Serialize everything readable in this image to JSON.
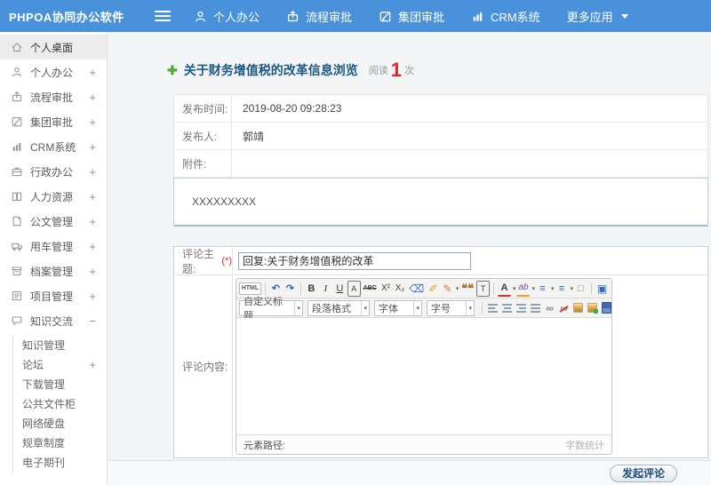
{
  "colors": {
    "header_blue": "#4a91dc",
    "title_blue": "#1c5a85",
    "count_red": "#e8222a",
    "plus_green": "#53a93f"
  },
  "header": {
    "logo": "PHPOA协同办公软件",
    "nav": [
      {
        "label": "个人办公",
        "icon": "user-icon"
      },
      {
        "label": "流程审批",
        "icon": "process-icon"
      },
      {
        "label": "集团审批",
        "icon": "edit-icon"
      },
      {
        "label": "CRM系统",
        "icon": "chart-icon"
      },
      {
        "label": "更多应用",
        "icon": "chevron-down-icon"
      }
    ]
  },
  "sidebar": {
    "items": [
      {
        "label": "个人桌面",
        "icon": "home-icon",
        "expand": "",
        "active": true
      },
      {
        "label": "个人办公",
        "icon": "user-icon",
        "expand": "+"
      },
      {
        "label": "流程审批",
        "icon": "process-icon",
        "expand": "+"
      },
      {
        "label": "集团审批",
        "icon": "edit-icon",
        "expand": "+"
      },
      {
        "label": "CRM系统",
        "icon": "chart-icon",
        "expand": "+"
      },
      {
        "label": "行政办公",
        "icon": "briefcase-icon",
        "expand": "+"
      },
      {
        "label": "人力资源",
        "icon": "book-icon",
        "expand": "+"
      },
      {
        "label": "公文管理",
        "icon": "document-icon",
        "expand": "+"
      },
      {
        "label": "用车管理",
        "icon": "truck-icon",
        "expand": "+"
      },
      {
        "label": "档案管理",
        "icon": "archive-icon",
        "expand": "+"
      },
      {
        "label": "项目管理",
        "icon": "project-icon",
        "expand": "+"
      },
      {
        "label": "知识交流",
        "icon": "chat-icon",
        "expand": "−"
      }
    ],
    "submenu": [
      {
        "label": "知识管理",
        "expand": ""
      },
      {
        "label": "论坛",
        "expand": "+"
      },
      {
        "label": "下载管理",
        "expand": ""
      },
      {
        "label": "公共文件柜",
        "expand": ""
      },
      {
        "label": "网络硬盘",
        "expand": ""
      },
      {
        "label": "规章制度",
        "expand": ""
      },
      {
        "label": "电子期刊",
        "expand": ""
      }
    ]
  },
  "main": {
    "title": "关于财务增值税的改革信息浏览",
    "read_label": "阅读",
    "read_count": "1",
    "read_unit": "次",
    "info": {
      "rows": [
        {
          "label": "发布时间:",
          "value": "2019-08-20 09:28:23"
        },
        {
          "label": "发布人:",
          "value": "郭靖"
        },
        {
          "label": "附件:",
          "value": ""
        }
      ],
      "content": "XXXXXXXXX"
    },
    "comment": {
      "subject_label": "评论主题:",
      "required_mark": "(*)",
      "subject_value": "回复:关于财务增值税的改革",
      "content_label": "评论内容:",
      "editor": {
        "caret_glyph": "▾",
        "row1": [
          {
            "name": "source-code-button",
            "glyph": "HTML"
          },
          {
            "name": "undo-button",
            "glyph": "↶"
          },
          {
            "name": "redo-button",
            "glyph": "↷"
          },
          {
            "name": "bold-button",
            "glyph": "B"
          },
          {
            "name": "italic-button",
            "glyph": "I"
          },
          {
            "name": "underline-button",
            "glyph": "U"
          },
          {
            "name": "font-style-button",
            "glyph": "A"
          },
          {
            "name": "strikethrough-button",
            "glyph": "ABC"
          },
          {
            "name": "superscript-button",
            "glyph": "X²"
          },
          {
            "name": "subscript-button",
            "glyph": "X₂"
          },
          {
            "name": "eraser-button",
            "glyph": "⌫"
          },
          {
            "name": "clear-format-button",
            "glyph": "✐"
          },
          {
            "name": "format-painter-button",
            "glyph": "✎"
          },
          {
            "name": "blockquote-button",
            "glyph": "❝❝"
          },
          {
            "name": "paste-text-button",
            "glyph": "T"
          },
          {
            "name": "font-color-button",
            "glyph": "A"
          },
          {
            "name": "highlight-color-button",
            "glyph": "ab"
          },
          {
            "name": "ordered-list-button",
            "glyph": "≡"
          },
          {
            "name": "unordered-list-button",
            "glyph": "≡"
          },
          {
            "name": "new-document-button",
            "glyph": "□"
          },
          {
            "name": "fullscreen-button",
            "glyph": "▣"
          }
        ],
        "row2_selects": [
          {
            "label": "自定义标题"
          },
          {
            "label": "段落格式"
          },
          {
            "label": "字体"
          },
          {
            "label": "字号"
          }
        ],
        "link_glyph": "∞",
        "table_glyph": "⊞",
        "statusbar_left": "元素路径:",
        "statusbar_right": "字数统计"
      }
    },
    "footer": {
      "submit_label": "发起评论"
    }
  }
}
